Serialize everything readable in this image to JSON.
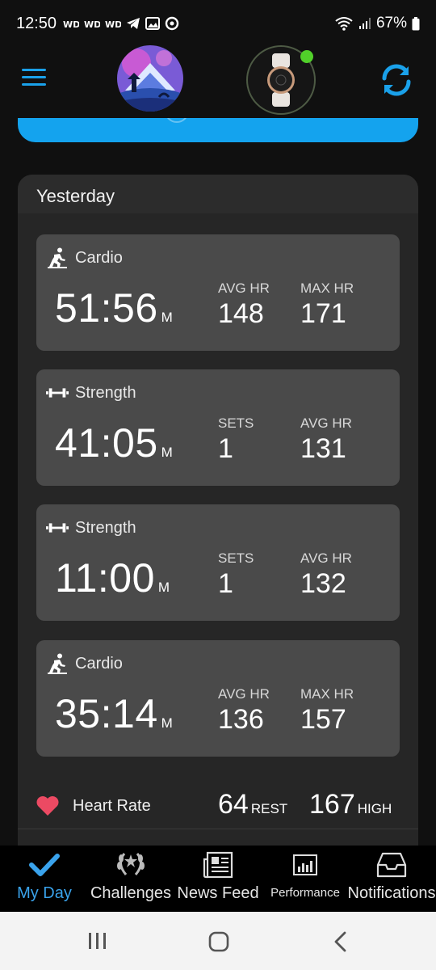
{
  "status_bar": {
    "time": "12:50",
    "battery": "67%"
  },
  "header": {
    "menu_icon": "hamburger-menu-icon",
    "avatar": "profile-avatar-mountain",
    "device": "watch-device-icon",
    "sync_icon": "sync-icon",
    "accent_color": "#1aa1ea",
    "connected_color": "#51d02a"
  },
  "section": {
    "title": "Yesterday"
  },
  "activities": [
    {
      "type": "Cardio",
      "icon": "cardio-stairs-icon",
      "duration": "51:56",
      "unit": "M",
      "stat1_label": "AVG HR",
      "stat1_value": "148",
      "stat2_label": "MAX HR",
      "stat2_value": "171"
    },
    {
      "type": "Strength",
      "icon": "dumbbell-icon",
      "duration": "41:05",
      "unit": "M",
      "stat1_label": "SETS",
      "stat1_value": "1",
      "stat2_label": "AVG HR",
      "stat2_value": "131"
    },
    {
      "type": "Strength",
      "icon": "dumbbell-icon",
      "duration": "11:00",
      "unit": "M",
      "stat1_label": "SETS",
      "stat1_value": "1",
      "stat2_label": "AVG HR",
      "stat2_value": "132"
    },
    {
      "type": "Cardio",
      "icon": "cardio-stairs-icon",
      "duration": "35:14",
      "unit": "M",
      "stat1_label": "AVG HR",
      "stat1_value": "136",
      "stat2_label": "MAX HR",
      "stat2_value": "157"
    }
  ],
  "heart_rate": {
    "label": "Heart Rate",
    "rest_value": "64",
    "rest_unit": "REST",
    "high_value": "167",
    "high_unit": "HIGH",
    "heart_color": "#ec4a63"
  },
  "bottom_nav": {
    "items": [
      {
        "label": "My Day",
        "icon": "checkmark-icon",
        "active": true
      },
      {
        "label": "Challenges",
        "icon": "laurel-icon",
        "active": false
      },
      {
        "label": "News Feed",
        "icon": "newspaper-icon",
        "active": false
      },
      {
        "label": "Performance",
        "icon": "performance-chart-icon",
        "active": false
      },
      {
        "label": "Notifications",
        "icon": "inbox-tray-icon",
        "active": false
      }
    ]
  }
}
